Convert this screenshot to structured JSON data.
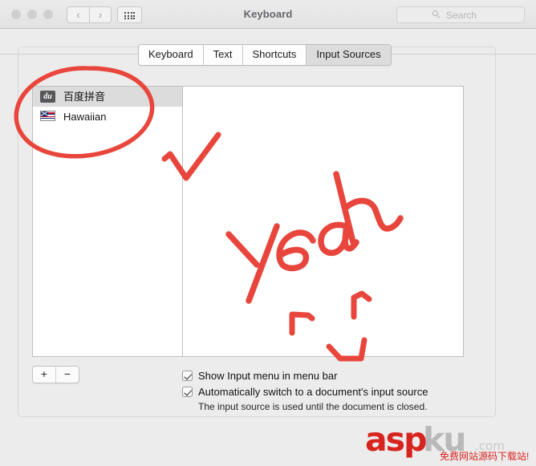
{
  "window": {
    "title": "Keyboard",
    "traffic_lights": [
      "close",
      "minimize",
      "maximize"
    ],
    "nav": {
      "back": "‹",
      "forward": "›"
    },
    "grid_button_icon": "grid-dots-icon"
  },
  "search": {
    "placeholder": "Search",
    "value": "",
    "icon": "search-icon"
  },
  "tabs": [
    {
      "label": "Keyboard",
      "selected": false
    },
    {
      "label": "Text",
      "selected": false
    },
    {
      "label": "Shortcuts",
      "selected": false
    },
    {
      "label": "Input Sources",
      "selected": true
    }
  ],
  "input_sources": [
    {
      "label": "百度拼音",
      "icon": "baidu-pinyin-icon",
      "icon_text": "du",
      "selected": true
    },
    {
      "label": "Hawaiian",
      "icon": "hawaiian-flag-icon",
      "selected": false
    }
  ],
  "list_controls": {
    "add_label": "+",
    "remove_label": "−"
  },
  "options": [
    {
      "label": "Show Input menu in menu bar",
      "checked": true
    },
    {
      "label": "Automatically switch to a document's input source",
      "checked": true
    }
  ],
  "help_text": "The input source is used until the document is closed.",
  "annotations": {
    "color": "#e8463c",
    "marks": [
      {
        "type": "ellipse",
        "name": "circled-input-sources"
      },
      {
        "type": "checkmark",
        "name": "check-mark"
      },
      {
        "type": "handwriting",
        "text": "yeah",
        "name": "yeah-scribble"
      },
      {
        "type": "smiley",
        "name": "smiley-face"
      }
    ]
  },
  "watermark": {
    "brand_red": "asp",
    "brand_gray": "ku",
    "domain": ".com",
    "tagline": "免费网站源码下载站!",
    "color_red": "#d8241f",
    "color_gray": "#b9b9b9"
  }
}
